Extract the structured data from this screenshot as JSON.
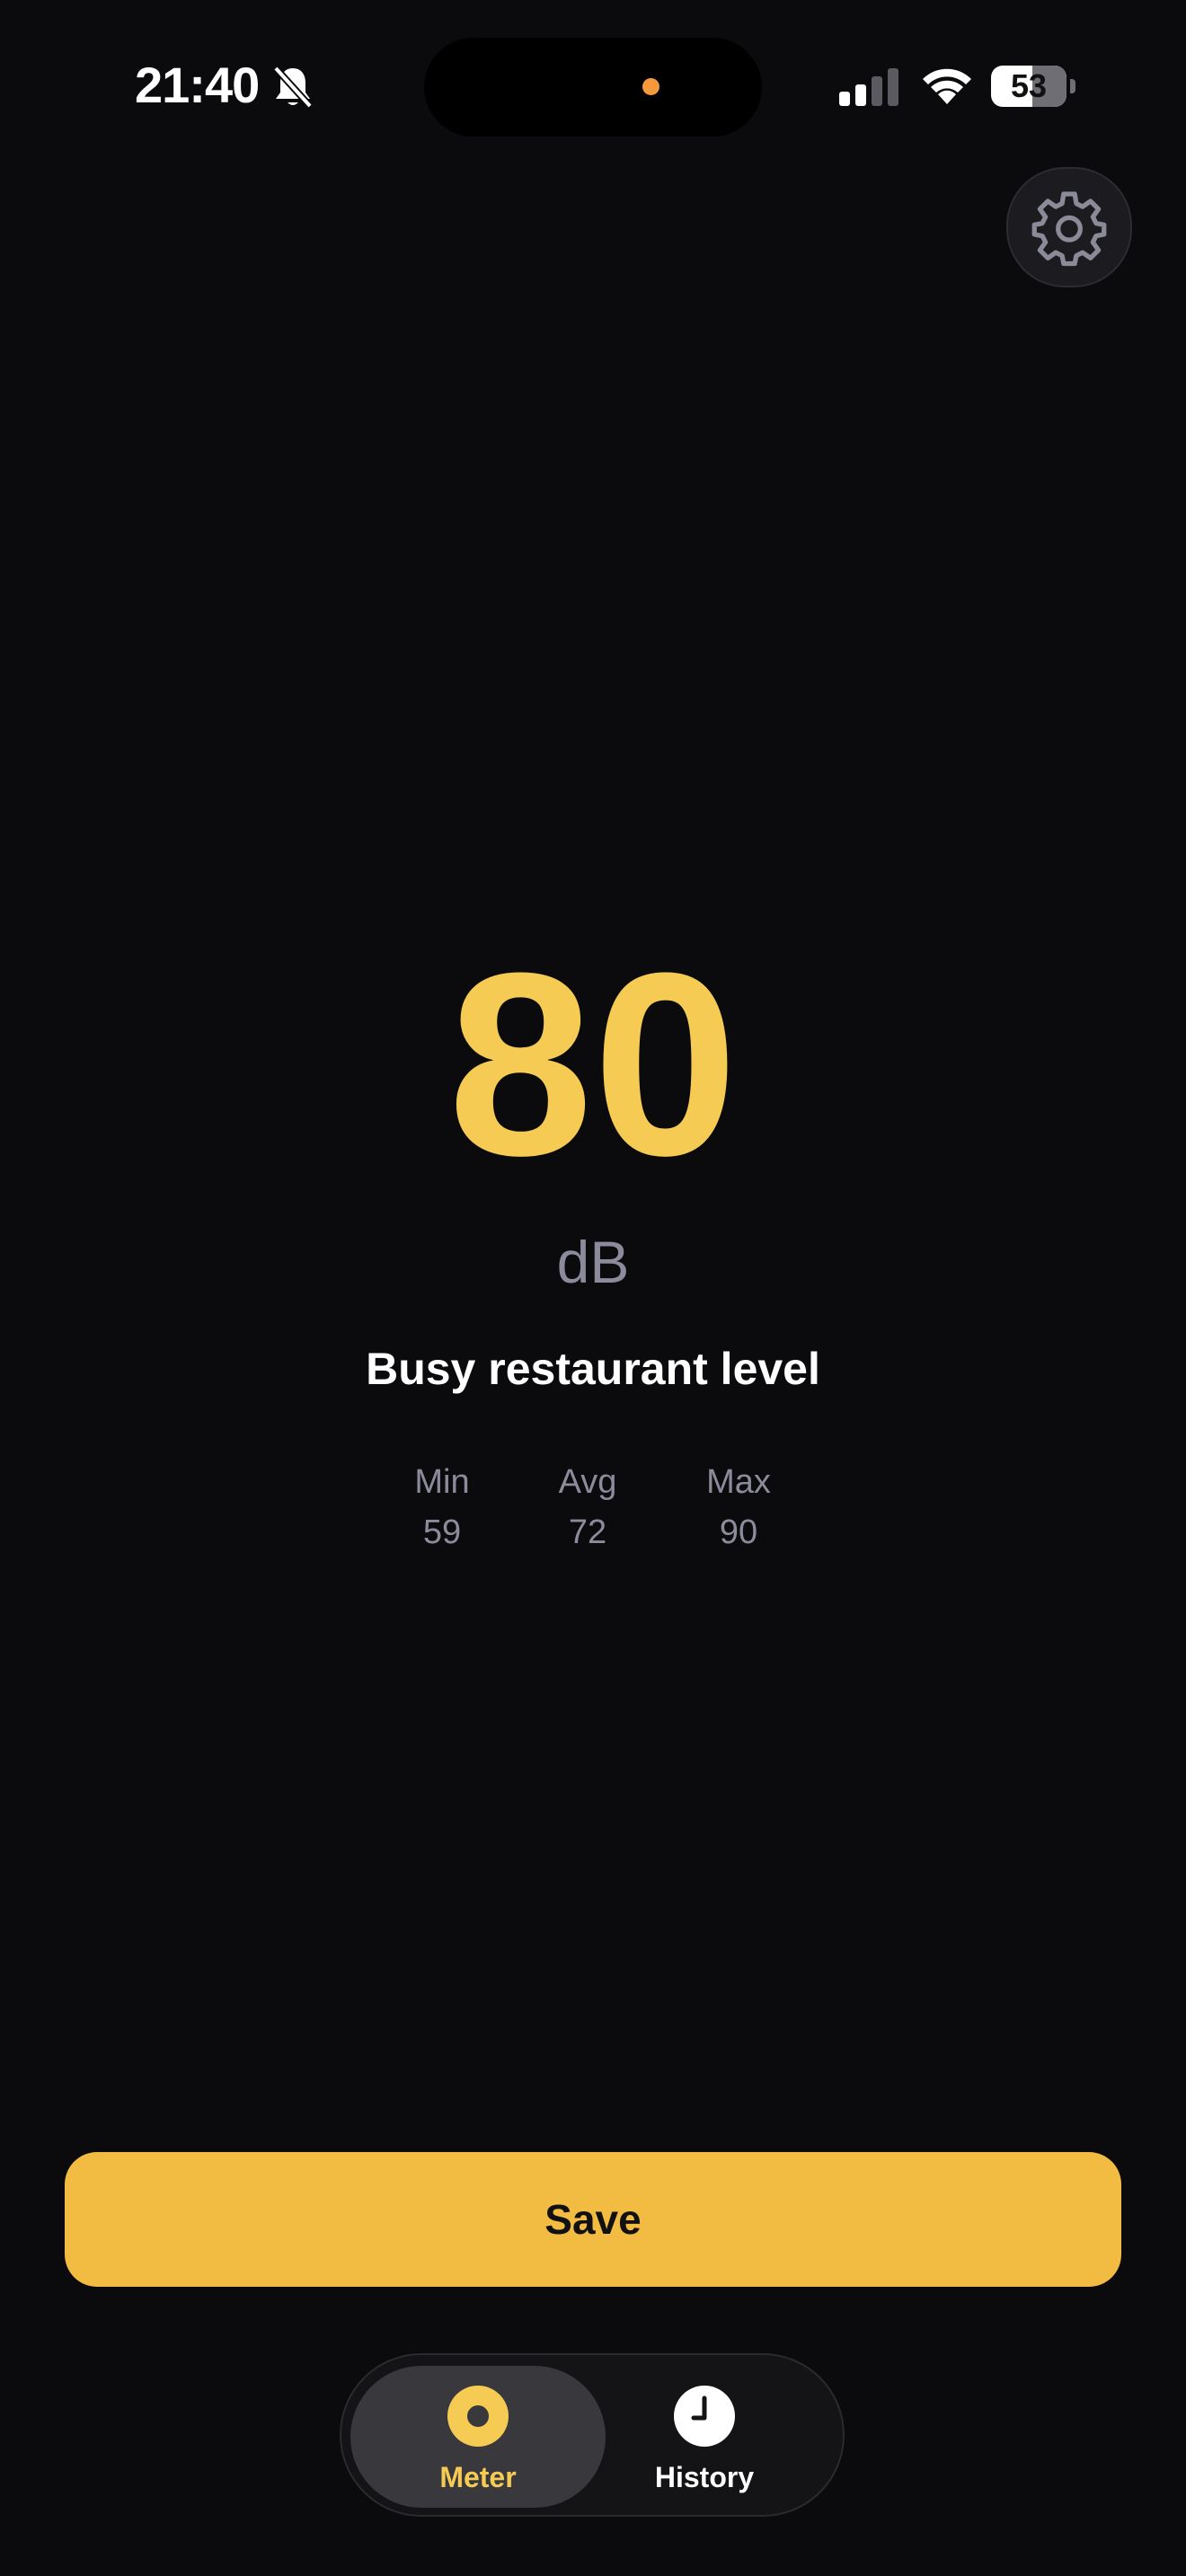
{
  "status_bar": {
    "time": "21:40",
    "battery": "53"
  },
  "meter": {
    "value": "80",
    "unit": "dB",
    "description": "Busy restaurant level",
    "stats": [
      {
        "label": "Min",
        "value": "59"
      },
      {
        "label": "Avg",
        "value": "72"
      },
      {
        "label": "Max",
        "value": "90"
      }
    ]
  },
  "actions": {
    "save_label": "Save"
  },
  "tabs": [
    {
      "label": "Meter",
      "selected": true
    },
    {
      "label": "History",
      "selected": false
    }
  ],
  "icons": {
    "settings": "gear-icon",
    "meter_tab": "meter-dot-icon",
    "history_tab": "clock-icon",
    "silent": "bell-off-icon"
  },
  "colors": {
    "accent": "#f5cb53",
    "save_button": "#f2bb41",
    "background": "#0b0b0e",
    "muted_text": "#8b8b9b"
  }
}
